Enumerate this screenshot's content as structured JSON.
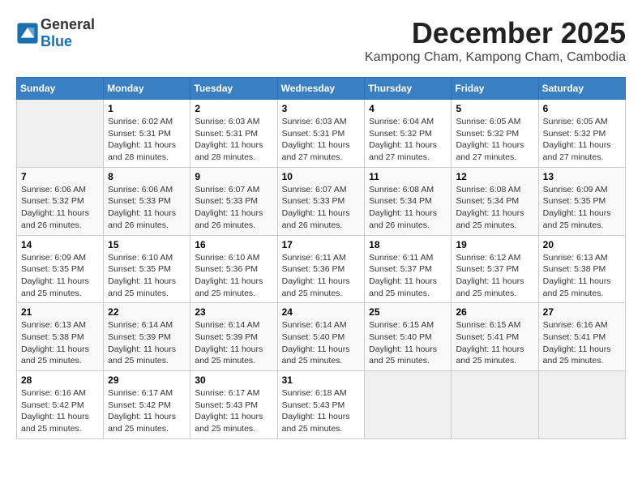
{
  "header": {
    "logo_general": "General",
    "logo_blue": "Blue",
    "month_title": "December 2025",
    "subtitle": "Kampong Cham, Kampong Cham, Cambodia"
  },
  "days_of_week": [
    "Sunday",
    "Monday",
    "Tuesday",
    "Wednesday",
    "Thursday",
    "Friday",
    "Saturday"
  ],
  "weeks": [
    [
      {
        "day": "",
        "sunrise": "",
        "sunset": "",
        "daylight": ""
      },
      {
        "day": "1",
        "sunrise": "Sunrise: 6:02 AM",
        "sunset": "Sunset: 5:31 PM",
        "daylight": "Daylight: 11 hours and 28 minutes."
      },
      {
        "day": "2",
        "sunrise": "Sunrise: 6:03 AM",
        "sunset": "Sunset: 5:31 PM",
        "daylight": "Daylight: 11 hours and 28 minutes."
      },
      {
        "day": "3",
        "sunrise": "Sunrise: 6:03 AM",
        "sunset": "Sunset: 5:31 PM",
        "daylight": "Daylight: 11 hours and 27 minutes."
      },
      {
        "day": "4",
        "sunrise": "Sunrise: 6:04 AM",
        "sunset": "Sunset: 5:32 PM",
        "daylight": "Daylight: 11 hours and 27 minutes."
      },
      {
        "day": "5",
        "sunrise": "Sunrise: 6:05 AM",
        "sunset": "Sunset: 5:32 PM",
        "daylight": "Daylight: 11 hours and 27 minutes."
      },
      {
        "day": "6",
        "sunrise": "Sunrise: 6:05 AM",
        "sunset": "Sunset: 5:32 PM",
        "daylight": "Daylight: 11 hours and 27 minutes."
      }
    ],
    [
      {
        "day": "7",
        "sunrise": "Sunrise: 6:06 AM",
        "sunset": "Sunset: 5:32 PM",
        "daylight": "Daylight: 11 hours and 26 minutes."
      },
      {
        "day": "8",
        "sunrise": "Sunrise: 6:06 AM",
        "sunset": "Sunset: 5:33 PM",
        "daylight": "Daylight: 11 hours and 26 minutes."
      },
      {
        "day": "9",
        "sunrise": "Sunrise: 6:07 AM",
        "sunset": "Sunset: 5:33 PM",
        "daylight": "Daylight: 11 hours and 26 minutes."
      },
      {
        "day": "10",
        "sunrise": "Sunrise: 6:07 AM",
        "sunset": "Sunset: 5:33 PM",
        "daylight": "Daylight: 11 hours and 26 minutes."
      },
      {
        "day": "11",
        "sunrise": "Sunrise: 6:08 AM",
        "sunset": "Sunset: 5:34 PM",
        "daylight": "Daylight: 11 hours and 26 minutes."
      },
      {
        "day": "12",
        "sunrise": "Sunrise: 6:08 AM",
        "sunset": "Sunset: 5:34 PM",
        "daylight": "Daylight: 11 hours and 25 minutes."
      },
      {
        "day": "13",
        "sunrise": "Sunrise: 6:09 AM",
        "sunset": "Sunset: 5:35 PM",
        "daylight": "Daylight: 11 hours and 25 minutes."
      }
    ],
    [
      {
        "day": "14",
        "sunrise": "Sunrise: 6:09 AM",
        "sunset": "Sunset: 5:35 PM",
        "daylight": "Daylight: 11 hours and 25 minutes."
      },
      {
        "day": "15",
        "sunrise": "Sunrise: 6:10 AM",
        "sunset": "Sunset: 5:35 PM",
        "daylight": "Daylight: 11 hours and 25 minutes."
      },
      {
        "day": "16",
        "sunrise": "Sunrise: 6:10 AM",
        "sunset": "Sunset: 5:36 PM",
        "daylight": "Daylight: 11 hours and 25 minutes."
      },
      {
        "day": "17",
        "sunrise": "Sunrise: 6:11 AM",
        "sunset": "Sunset: 5:36 PM",
        "daylight": "Daylight: 11 hours and 25 minutes."
      },
      {
        "day": "18",
        "sunrise": "Sunrise: 6:11 AM",
        "sunset": "Sunset: 5:37 PM",
        "daylight": "Daylight: 11 hours and 25 minutes."
      },
      {
        "day": "19",
        "sunrise": "Sunrise: 6:12 AM",
        "sunset": "Sunset: 5:37 PM",
        "daylight": "Daylight: 11 hours and 25 minutes."
      },
      {
        "day": "20",
        "sunrise": "Sunrise: 6:13 AM",
        "sunset": "Sunset: 5:38 PM",
        "daylight": "Daylight: 11 hours and 25 minutes."
      }
    ],
    [
      {
        "day": "21",
        "sunrise": "Sunrise: 6:13 AM",
        "sunset": "Sunset: 5:38 PM",
        "daylight": "Daylight: 11 hours and 25 minutes."
      },
      {
        "day": "22",
        "sunrise": "Sunrise: 6:14 AM",
        "sunset": "Sunset: 5:39 PM",
        "daylight": "Daylight: 11 hours and 25 minutes."
      },
      {
        "day": "23",
        "sunrise": "Sunrise: 6:14 AM",
        "sunset": "Sunset: 5:39 PM",
        "daylight": "Daylight: 11 hours and 25 minutes."
      },
      {
        "day": "24",
        "sunrise": "Sunrise: 6:14 AM",
        "sunset": "Sunset: 5:40 PM",
        "daylight": "Daylight: 11 hours and 25 minutes."
      },
      {
        "day": "25",
        "sunrise": "Sunrise: 6:15 AM",
        "sunset": "Sunset: 5:40 PM",
        "daylight": "Daylight: 11 hours and 25 minutes."
      },
      {
        "day": "26",
        "sunrise": "Sunrise: 6:15 AM",
        "sunset": "Sunset: 5:41 PM",
        "daylight": "Daylight: 11 hours and 25 minutes."
      },
      {
        "day": "27",
        "sunrise": "Sunrise: 6:16 AM",
        "sunset": "Sunset: 5:41 PM",
        "daylight": "Daylight: 11 hours and 25 minutes."
      }
    ],
    [
      {
        "day": "28",
        "sunrise": "Sunrise: 6:16 AM",
        "sunset": "Sunset: 5:42 PM",
        "daylight": "Daylight: 11 hours and 25 minutes."
      },
      {
        "day": "29",
        "sunrise": "Sunrise: 6:17 AM",
        "sunset": "Sunset: 5:42 PM",
        "daylight": "Daylight: 11 hours and 25 minutes."
      },
      {
        "day": "30",
        "sunrise": "Sunrise: 6:17 AM",
        "sunset": "Sunset: 5:43 PM",
        "daylight": "Daylight: 11 hours and 25 minutes."
      },
      {
        "day": "31",
        "sunrise": "Sunrise: 6:18 AM",
        "sunset": "Sunset: 5:43 PM",
        "daylight": "Daylight: 11 hours and 25 minutes."
      },
      {
        "day": "",
        "sunrise": "",
        "sunset": "",
        "daylight": ""
      },
      {
        "day": "",
        "sunrise": "",
        "sunset": "",
        "daylight": ""
      },
      {
        "day": "",
        "sunrise": "",
        "sunset": "",
        "daylight": ""
      }
    ]
  ]
}
